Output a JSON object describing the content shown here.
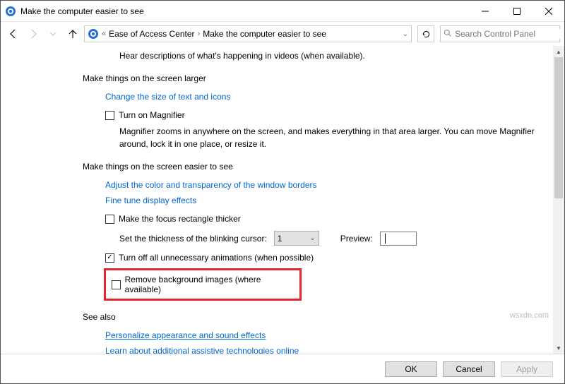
{
  "titlebar": {
    "text": "Make the computer easier to see"
  },
  "breadcrumb": {
    "p1": "Ease of Access Center",
    "p2": "Make the computer easier to see"
  },
  "search": {
    "placeholder": "Search Control Panel"
  },
  "line_top": "Hear descriptions of what's happening in videos (when available).",
  "section_larger": {
    "heading": "Make things on the screen larger",
    "link_size": "Change the size of text and icons",
    "cb_magnifier": "Turn on Magnifier",
    "magnifier_desc": "Magnifier zooms in anywhere on the screen, and makes everything in that area larger. You can move Magnifier around, lock it in one place, or resize it."
  },
  "section_easier": {
    "heading": "Make things on the screen easier to see",
    "link_color": "Adjust the color and transparency of the window borders",
    "link_fine": "Fine tune display effects",
    "cb_focus": "Make the focus rectangle thicker",
    "cursor_label": "Set the thickness of the blinking cursor:",
    "cursor_value": "1",
    "preview_label": "Preview:",
    "cb_anim": "Turn off all unnecessary animations (when possible)",
    "cb_bg": "Remove background images (where available)"
  },
  "see_also": {
    "heading": "See also",
    "link_personalize": "Personalize appearance and sound effects",
    "link_learn": "Learn about additional assistive technologies online"
  },
  "buttons": {
    "ok": "OK",
    "cancel": "Cancel",
    "apply": "Apply"
  },
  "watermark": "wsxdn.com"
}
